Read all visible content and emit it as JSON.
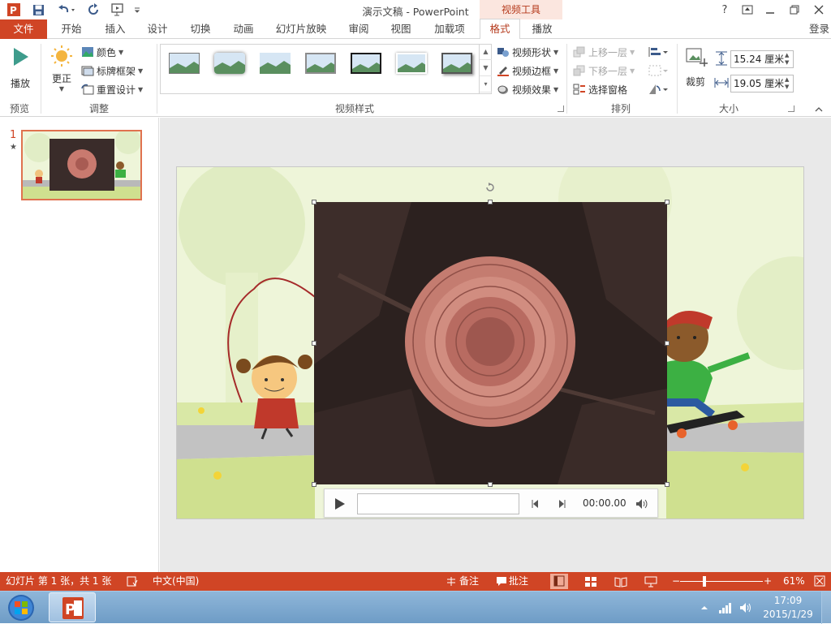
{
  "window": {
    "title": "演示文稿 - PowerPoint",
    "context_group": "视频工具",
    "help": "?",
    "login": "登录"
  },
  "tabs": {
    "file": "文件",
    "home": "开始",
    "insert": "插入",
    "design": "设计",
    "transitions": "切换",
    "animations": "动画",
    "slideshow": "幻灯片放映",
    "review": "审阅",
    "view": "视图",
    "addins": "加载项",
    "format": "格式",
    "playback": "播放"
  },
  "ribbon": {
    "preview": {
      "play": "播放",
      "label": "预览"
    },
    "adjust": {
      "corrections": "更正",
      "color": "颜色",
      "poster_frame": "标牌框架",
      "reset_design": "重置设计",
      "label": "调整"
    },
    "video_styles": {
      "label": "视频样式",
      "shape": "视频形状",
      "border": "视频边框",
      "effects": "视频效果"
    },
    "arrange": {
      "bring_forward": "上移一层",
      "send_backward": "下移一层",
      "selection_pane": "选择窗格",
      "label": "排列"
    },
    "size": {
      "crop": "裁剪",
      "height": "15.24 厘米",
      "width": "19.05 厘米",
      "label": "大小"
    }
  },
  "thumbnail": {
    "number": "1",
    "star": "★"
  },
  "player": {
    "time": "00:00.00"
  },
  "status": {
    "slide_info": "幻灯片 第 1 张，共 1 张",
    "language": "中文(中国)",
    "notes": "备注",
    "comments": "批注",
    "zoom": "61%"
  },
  "taskbar": {
    "time": "17:09",
    "date": "2015/1/29"
  },
  "colors": {
    "accent": "#d04525",
    "context_tab": "#b5391b",
    "slide_bg": "#eef5d9"
  }
}
